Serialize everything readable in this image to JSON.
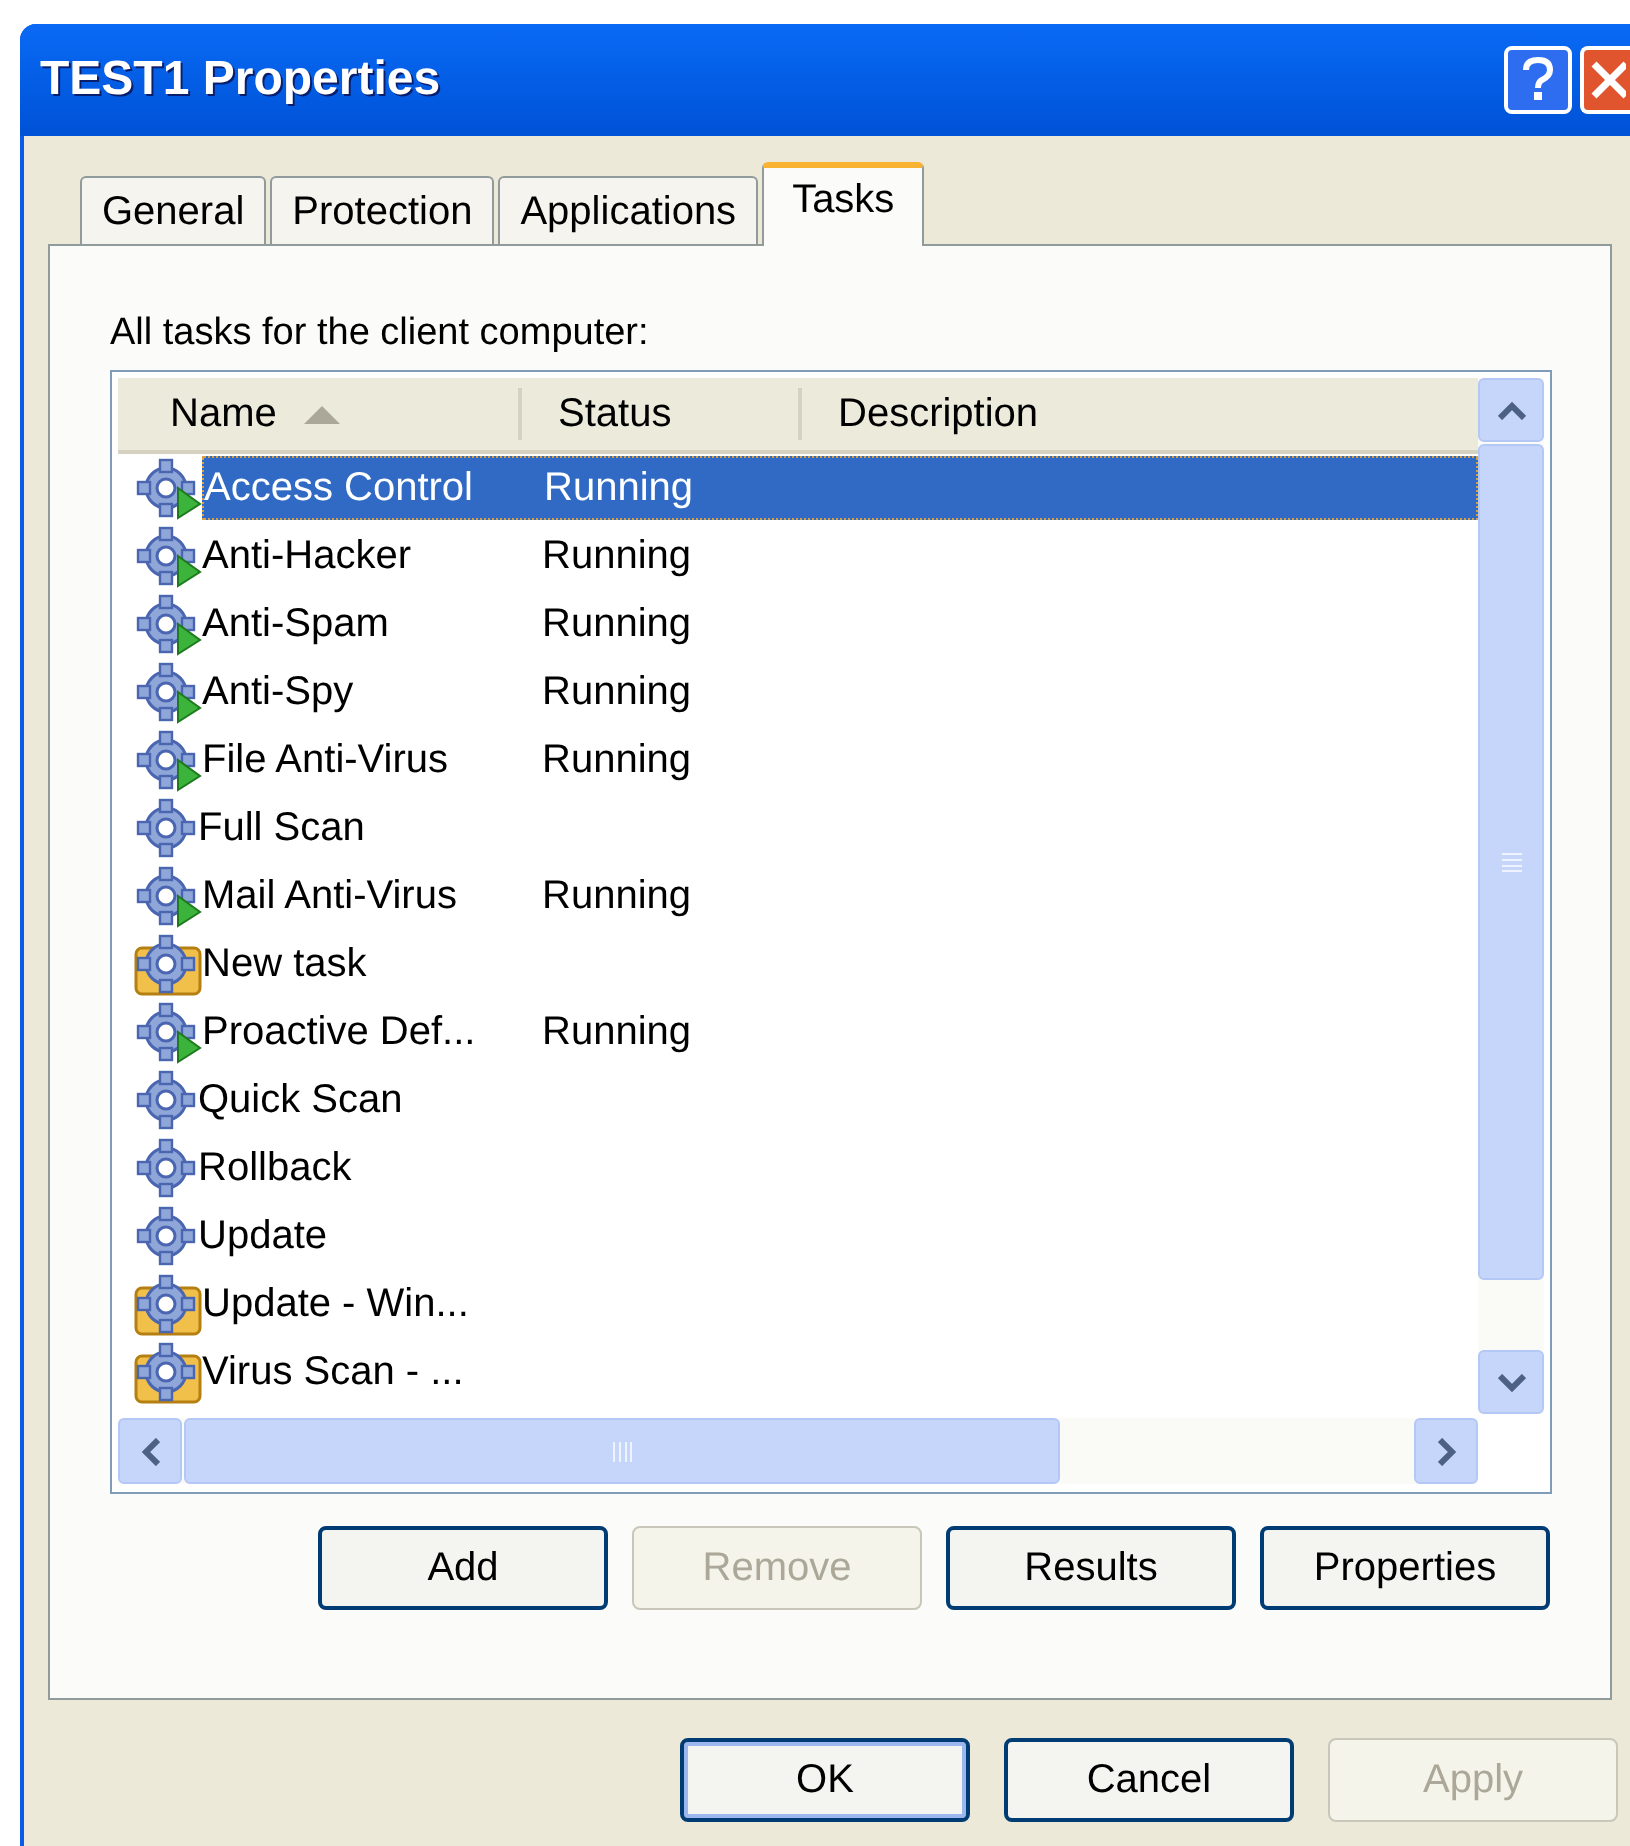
{
  "window": {
    "title": "TEST1 Properties"
  },
  "tabs": [
    {
      "label": "General",
      "selected": false
    },
    {
      "label": "Protection",
      "selected": false
    },
    {
      "label": "Applications",
      "selected": false
    },
    {
      "label": "Tasks",
      "selected": true
    }
  ],
  "list_label": "All tasks for the client computer:",
  "table": {
    "columns": [
      {
        "label": "Name",
        "sorted": true
      },
      {
        "label": "Status",
        "sorted": false
      },
      {
        "label": "Description",
        "sorted": false
      }
    ],
    "rows": [
      {
        "name": "Access Control",
        "status": "Running",
        "kind": "running",
        "selected": true
      },
      {
        "name": "Anti-Hacker",
        "status": "Running",
        "kind": "running",
        "selected": false
      },
      {
        "name": "Anti-Spam",
        "status": "Running",
        "kind": "running",
        "selected": false
      },
      {
        "name": "Anti-Spy",
        "status": "Running",
        "kind": "running",
        "selected": false
      },
      {
        "name": "File Anti-Virus",
        "status": "Running",
        "kind": "running",
        "selected": false
      },
      {
        "name": "Full Scan",
        "kind": "idle",
        "selected": false
      },
      {
        "name": "Mail Anti-Virus",
        "status": "Running",
        "kind": "running",
        "selected": false
      },
      {
        "name": "New task",
        "kind": "custom",
        "selected": false
      },
      {
        "name": "Proactive Def...",
        "status": "Running",
        "kind": "running",
        "selected": false
      },
      {
        "name": "Quick Scan",
        "kind": "idle",
        "selected": false
      },
      {
        "name": "Rollback",
        "kind": "idle",
        "selected": false
      },
      {
        "name": "Update",
        "kind": "idle",
        "selected": false
      },
      {
        "name": "Update - Win...",
        "kind": "custom",
        "selected": false
      },
      {
        "name": "Virus Scan - ...",
        "kind": "custom",
        "selected": false
      }
    ]
  },
  "list_buttons": [
    {
      "label": "Add",
      "disabled": false
    },
    {
      "label": "Remove",
      "disabled": true
    },
    {
      "label": "Results",
      "disabled": false
    },
    {
      "label": "Properties",
      "disabled": false
    }
  ],
  "dialog_buttons": [
    {
      "label": "OK",
      "disabled": false,
      "default": true
    },
    {
      "label": "Cancel",
      "disabled": false,
      "default": false
    },
    {
      "label": "Apply",
      "disabled": true,
      "default": false
    }
  ]
}
